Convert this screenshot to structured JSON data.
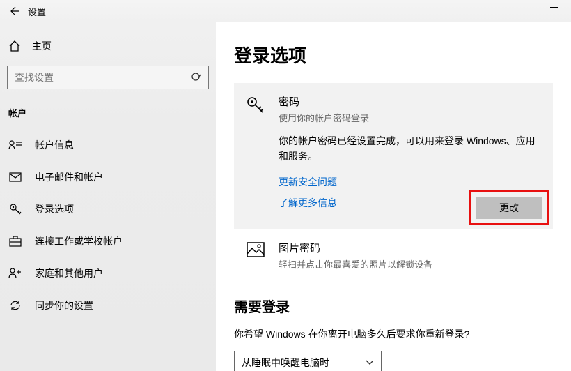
{
  "window": {
    "title": "设置"
  },
  "sidebar": {
    "home": "主页",
    "search_placeholder": "查找设置",
    "category": "帐户",
    "items": [
      {
        "label": "帐户信息"
      },
      {
        "label": "电子邮件和帐户"
      },
      {
        "label": "登录选项"
      },
      {
        "label": "连接工作或学校帐户"
      },
      {
        "label": "家庭和其他用户"
      },
      {
        "label": "同步你的设置"
      }
    ]
  },
  "main": {
    "title": "登录选项",
    "password": {
      "title": "密码",
      "subtitle": "使用你的帐户密码登录",
      "desc": "你的帐户密码已经设置完成，可以用来登录 Windows、应用和服务。",
      "link_security": "更新安全问题",
      "link_learn": "了解更多信息",
      "change_btn": "更改"
    },
    "picture": {
      "title": "图片密码",
      "subtitle": "轻扫并点击你最喜爱的照片以解锁设备"
    },
    "require_signin": {
      "heading": "需要登录",
      "question": "你希望 Windows 在你离开电脑多久后要求你重新登录?",
      "selected": "从睡眠中唤醒电脑时"
    }
  }
}
